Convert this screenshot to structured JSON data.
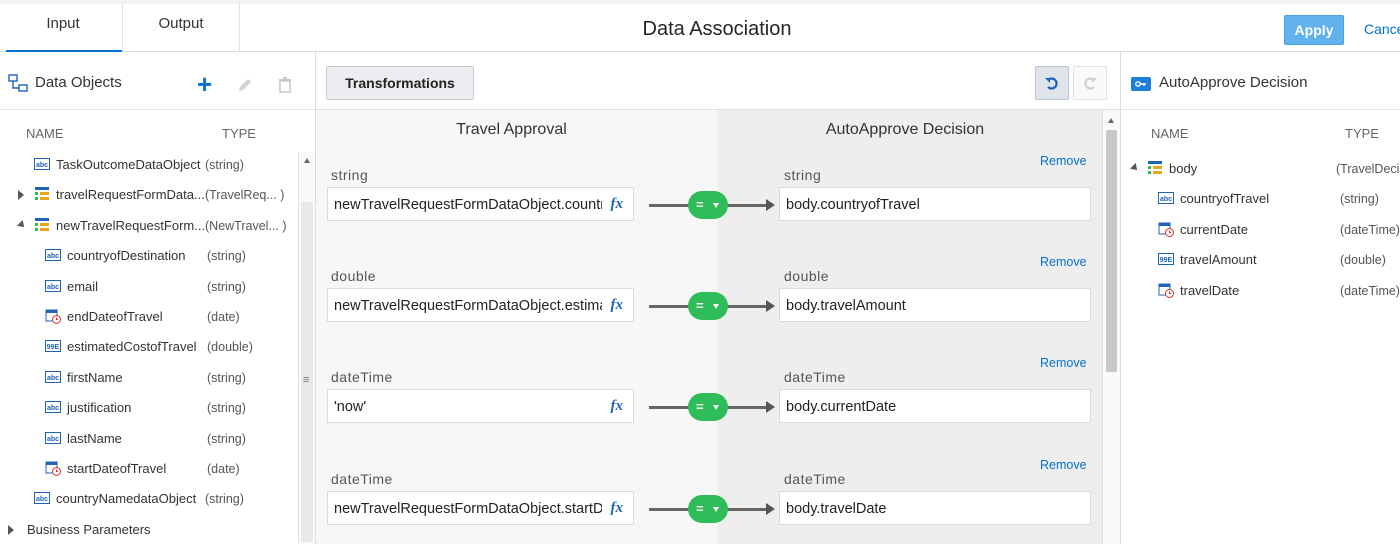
{
  "tabs": [
    {
      "label": "Input",
      "active": true
    },
    {
      "label": "Output",
      "active": false
    }
  ],
  "header": {
    "title": "Data Association",
    "apply_label": "Apply",
    "cancel_label": "Cancel"
  },
  "colors": {
    "accent": "#0572ce",
    "apply_button": "#61b2ec",
    "operator_pill": "#2ebd59"
  },
  "left_panel": {
    "title": "Data Objects",
    "toolbar": [
      {
        "icon": "add-icon"
      },
      {
        "icon": "edit-icon"
      },
      {
        "icon": "delete-icon"
      }
    ],
    "columns": {
      "name": "NAME",
      "type": "TYPE"
    },
    "items": [
      {
        "name": "TaskOutcomeDataObject",
        "type": "(string)",
        "icon": "text-type-icon"
      },
      {
        "name": "travelRequestFormData...",
        "type": "(TravelReq... )",
        "icon": "business-object-icon",
        "expand": "closed"
      },
      {
        "name": "newTravelRequestForm...",
        "type": "(NewTravel... )",
        "icon": "business-object-icon",
        "expand": "open"
      },
      {
        "name": "countryofDestination",
        "type": "(string)",
        "icon": "text-type-icon",
        "child": true
      },
      {
        "name": "email",
        "type": "(string)",
        "icon": "text-type-icon",
        "child": true
      },
      {
        "name": "endDateofTravel",
        "type": "(date)",
        "icon": "calendar-icon",
        "child": true
      },
      {
        "name": "estimatedCostofTravel",
        "type": "(double)",
        "icon": "number-type-icon",
        "child": true
      },
      {
        "name": "firstName",
        "type": "(string)",
        "icon": "text-type-icon",
        "child": true
      },
      {
        "name": "justification",
        "type": "(string)",
        "icon": "text-type-icon",
        "child": true
      },
      {
        "name": "lastName",
        "type": "(string)",
        "icon": "text-type-icon",
        "child": true
      },
      {
        "name": "startDateofTravel",
        "type": "(date)",
        "icon": "calendar-icon",
        "child": true
      },
      {
        "name": "countryNamedataObject",
        "type": "(string)",
        "icon": "text-type-icon"
      }
    ],
    "section": "Business Parameters"
  },
  "center": {
    "transformations_label": "Transformations",
    "source_title": "Travel Approval",
    "target_title": "AutoApprove Decision",
    "fx_label": "fx",
    "operator_label": "=",
    "remove_label": "Remove",
    "mappings": [
      {
        "source_type": "string",
        "source": "newTravelRequestFormDataObject.countryofDestination",
        "target_type": "string",
        "target": "body.countryofTravel"
      },
      {
        "source_type": "double",
        "source": "newTravelRequestFormDataObject.estimatedCostofTravel",
        "target_type": "double",
        "target": "body.travelAmount"
      },
      {
        "source_type": "dateTime",
        "source": "'now'",
        "target_type": "dateTime",
        "target": "body.currentDate"
      },
      {
        "source_type": "dateTime",
        "source": "newTravelRequestFormDataObject.startDateofTravel",
        "target_type": "dateTime",
        "target": "body.travelDate"
      }
    ]
  },
  "right_panel": {
    "title": "AutoApprove Decision",
    "columns": {
      "name": "NAME",
      "type": "TYPE"
    },
    "root": {
      "name": "body",
      "type": "(TravelDecision)",
      "icon": "business-object-icon"
    },
    "items": [
      {
        "name": "countryofTravel",
        "type": "(string)",
        "icon": "text-type-icon"
      },
      {
        "name": "currentDate",
        "type": "(dateTime)",
        "icon": "calendar-icon"
      },
      {
        "name": "travelAmount",
        "type": "(double)",
        "icon": "number-type-icon"
      },
      {
        "name": "travelDate",
        "type": "(dateTime)",
        "icon": "calendar-icon"
      }
    ]
  }
}
